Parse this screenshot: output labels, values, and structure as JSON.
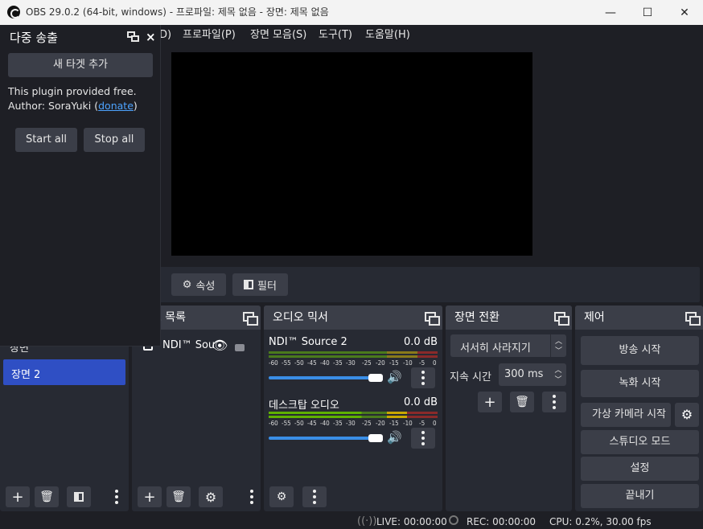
{
  "window": {
    "title": "OBS 29.0.2 (64-bit, windows) - 프로파일: 제목 없음 - 장면: 제목 없음",
    "minimize_glyph": "—",
    "maximize_glyph": "☐",
    "close_glyph": "✕"
  },
  "menubar": {
    "items": [
      "D)",
      "프로파일(P)",
      "장면 모음(S)",
      "도구(T)",
      "도움말(H)"
    ]
  },
  "multi_output": {
    "title": "다중 송출",
    "add_target_label": "새 타겟 추가",
    "info_line1": "This plugin provided free.",
    "author_prefix": "Author: SoraYuki (",
    "donate_label": "donate",
    "author_suffix": ")",
    "start_all_label": "Start all",
    "stop_all_label": "Stop all"
  },
  "source_toolbar": {
    "properties_label": "속성",
    "filters_label": "필터"
  },
  "scenes": {
    "items": [
      "장면",
      "장면 2"
    ],
    "selected": "장면 2"
  },
  "sources": {
    "title": "소스 목록",
    "items": [
      {
        "name": "NDI™ Sou",
        "visible": true,
        "locked": false
      }
    ]
  },
  "audio_mixer": {
    "title": "오디오 믹서",
    "channels": [
      {
        "name": "NDI™ Source 2",
        "db": "0.0 dB",
        "volume": 1.0
      },
      {
        "name": "데스크탑 오디오",
        "db": "0.0 dB",
        "volume": 1.0
      }
    ],
    "scale": [
      "-60",
      "-55",
      "-50",
      "-45",
      "-40",
      "-35",
      "-30",
      "-25",
      "-20",
      "-15",
      "-10",
      "-5",
      "0"
    ]
  },
  "transitions": {
    "title": "장면 전환",
    "selected": "서서히 사라지기",
    "duration_label": "지속 시간",
    "duration_value": "300 ms"
  },
  "controls": {
    "title": "제어",
    "start_streaming": "방송 시작",
    "start_recording": "녹화 시작",
    "virtual_camera": "가상 카메라 시작",
    "studio_mode": "스튜디오 모드",
    "settings": "설정",
    "exit": "끝내기"
  },
  "status": {
    "live": "LIVE: 00:00:00",
    "rec": "REC: 00:00:00",
    "cpu": "CPU: 0.2%, 30.00 fps"
  },
  "colors": {
    "accent": "#2f4fc4",
    "panel": "#272a33",
    "button": "#3b3e48",
    "meter_green": "#5fb000",
    "meter_yellow": "#c9a800",
    "meter_red": "#c0392b"
  }
}
